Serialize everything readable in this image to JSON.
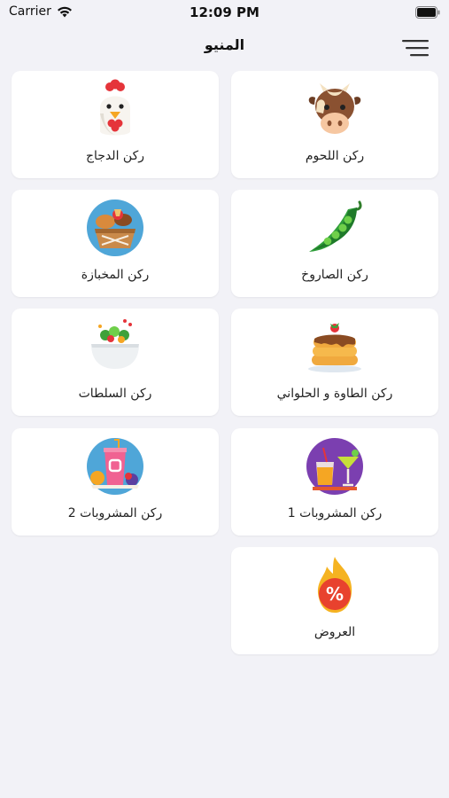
{
  "status": {
    "carrier": "Carrier",
    "time": "12:09 PM"
  },
  "nav": {
    "title": "المنيو"
  },
  "categories": [
    {
      "label": "ركن اللحوم",
      "icon": "cow-icon"
    },
    {
      "label": "ركن الدجاج",
      "icon": "chicken-icon"
    },
    {
      "label": "ركن الصاروخ",
      "icon": "pea-pod-icon"
    },
    {
      "label": "ركن المخبازة",
      "icon": "bread-basket-icon"
    },
    {
      "label": "ركن الطاوة و الحلواني",
      "icon": "pancakes-icon"
    },
    {
      "label": "ركن السلطات",
      "icon": "salad-bowl-icon"
    },
    {
      "label": "ركن المشروبات 1",
      "icon": "cocktail-icon"
    },
    {
      "label": "ركن المشروبات 2",
      "icon": "juice-cup-icon"
    },
    {
      "label": "العروض",
      "icon": "discount-fire-icon"
    }
  ]
}
